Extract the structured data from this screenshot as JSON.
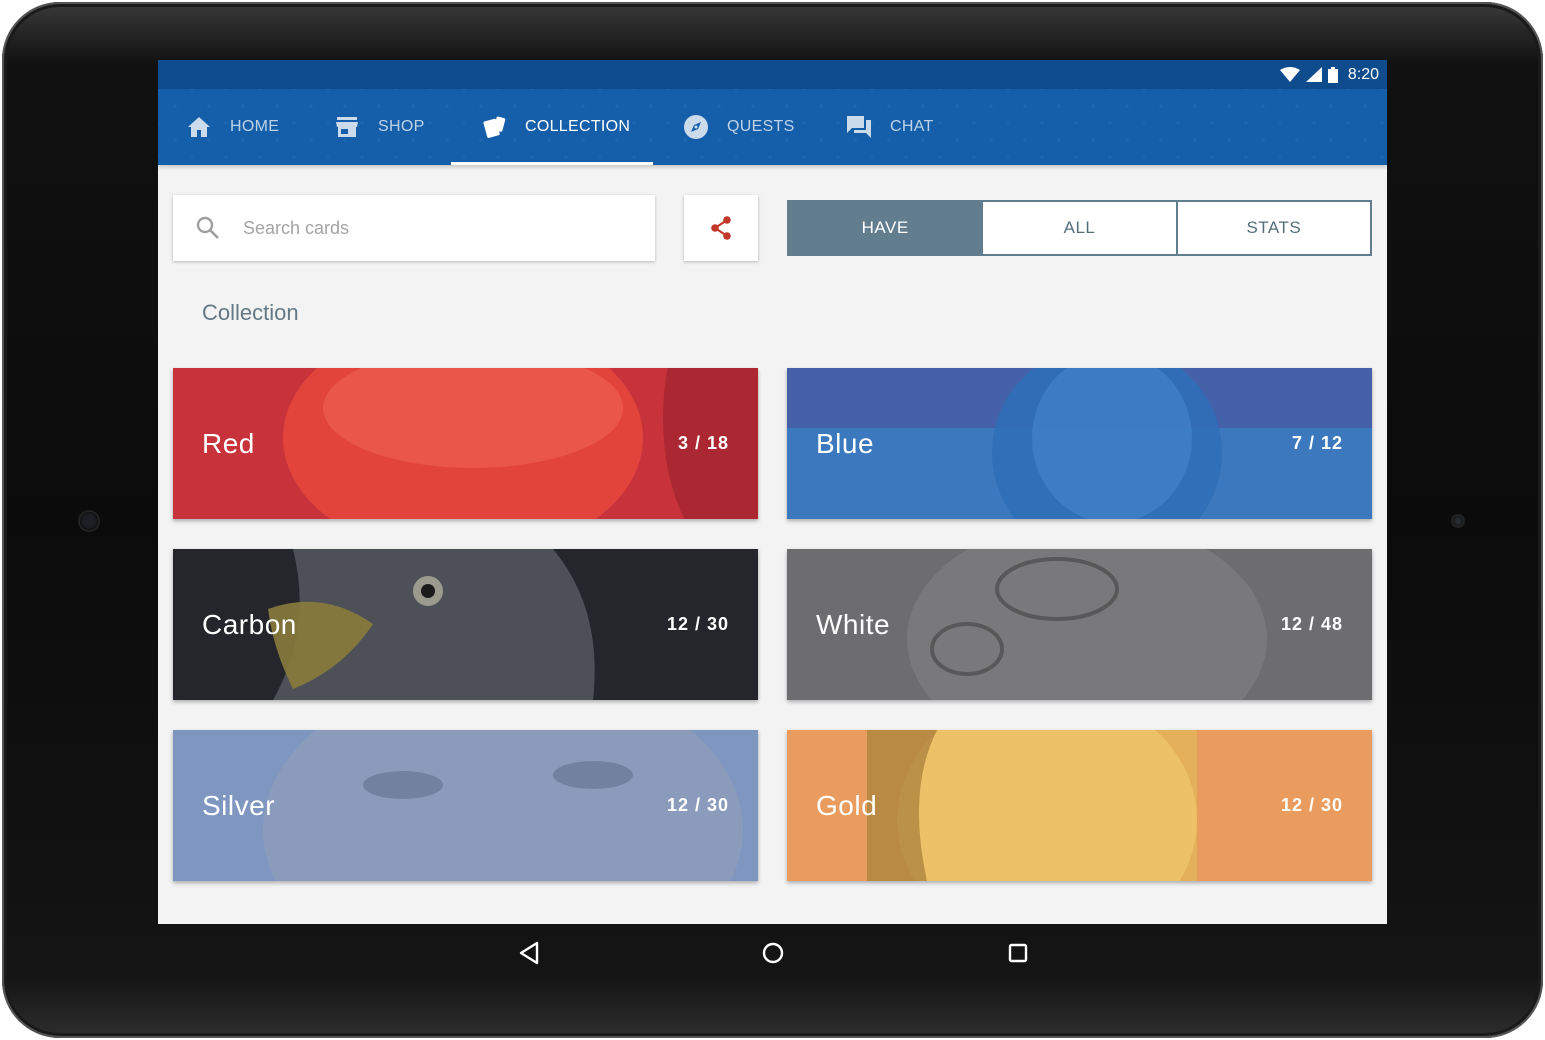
{
  "status_bar": {
    "time": "8:20",
    "icons": [
      "wifi-icon",
      "cell-signal-icon",
      "battery-icon"
    ]
  },
  "tabs": [
    {
      "label": "HOME",
      "icon": "home-icon",
      "active": false
    },
    {
      "label": "SHOP",
      "icon": "store-icon",
      "active": false
    },
    {
      "label": "COLLECTION",
      "icon": "cards-icon",
      "active": true
    },
    {
      "label": "QUESTS",
      "icon": "compass-icon",
      "active": false
    },
    {
      "label": "CHAT",
      "icon": "chat-icon",
      "active": false
    }
  ],
  "search": {
    "placeholder": "Search cards",
    "value": ""
  },
  "filter": {
    "options": [
      "HAVE",
      "ALL",
      "STATS"
    ],
    "selected": "HAVE"
  },
  "section_title": "Collection",
  "collections": [
    {
      "name": "Red",
      "count": "3 / 18",
      "color": "#c8323a"
    },
    {
      "name": "Blue",
      "count": "7 / 12",
      "color": "#3c78bd"
    },
    {
      "name": "Carbon",
      "count": "12 / 30",
      "color": "#25262c"
    },
    {
      "name": "White",
      "count": "12 / 48",
      "color": "#6d6d6f"
    },
    {
      "name": "Silver",
      "count": "12 / 30",
      "color": "#7f96c1"
    },
    {
      "name": "Gold",
      "count": "12 / 30",
      "color": "#ea9c5e"
    }
  ],
  "colors": {
    "app_bar": "#155ea9",
    "status_bar": "#0f4c8e",
    "accent": "#617d8e",
    "share_icon": "#c0392b",
    "background": "#f3f3f3"
  },
  "nav_bar": [
    "back-icon",
    "home-circle-icon",
    "recents-icon"
  ]
}
